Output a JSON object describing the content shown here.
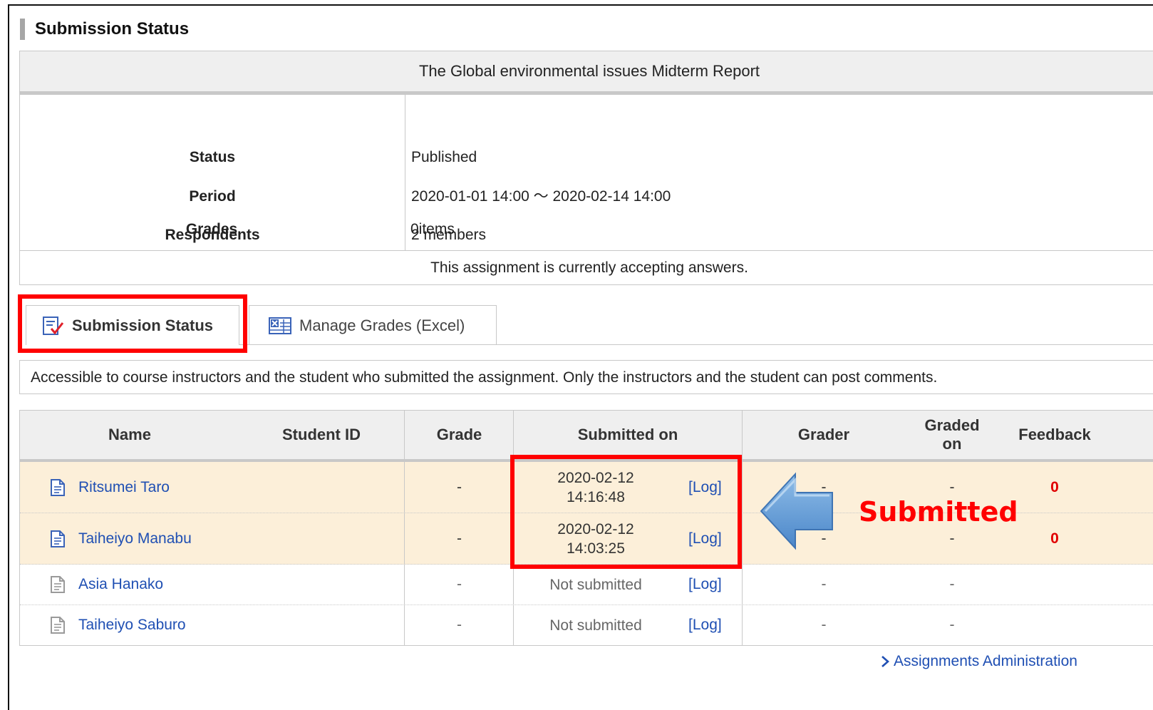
{
  "page_title": "Submission Status",
  "assignment": {
    "title": "The Global environmental issues Midterm Report",
    "rows": [
      {
        "label": "Status",
        "value": "Published"
      },
      {
        "label": "Period",
        "value": "2020-01-01 14:00 ～ 2020-02-14 14:00"
      },
      {
        "label": "Respondents",
        "value": "2 members"
      },
      {
        "label": "Grades",
        "value": "0items"
      }
    ],
    "note": "This assignment is currently accepting answers."
  },
  "tabs": [
    {
      "label": "Submission Status",
      "icon": "checklist-icon",
      "active": true
    },
    {
      "label": "Manage Grades (Excel)",
      "icon": "spreadsheet-icon",
      "active": false
    }
  ],
  "access_note": "Accessible to course instructors and the student who submitted the assignment. Only the instructors and the student can post comments.",
  "table": {
    "headers": {
      "name": "Name",
      "student_id": "Student ID",
      "grade": "Grade",
      "submitted_on": "Submitted on",
      "grader": "Grader",
      "graded_on_1": "Graded",
      "graded_on_2": "on",
      "feedback": "Feedback"
    },
    "rows": [
      {
        "name": "Ritsumei Taro",
        "grade": "-",
        "submitted_date": "2020-02-12",
        "submitted_time": "14:16:48",
        "log": "[Log]",
        "grader": "-",
        "graded_on": "-",
        "feedback": "0"
      },
      {
        "name": "Taiheiyo Manabu",
        "grade": "-",
        "submitted_date": "2020-02-12",
        "submitted_time": "14:03:25",
        "log": "[Log]",
        "grader": "-",
        "graded_on": "-",
        "feedback": "0"
      },
      {
        "name": "Asia Hanako",
        "grade": "-",
        "submitted": "Not submitted",
        "log": "[Log]",
        "grader": "-",
        "graded_on": "-"
      },
      {
        "name": "Taiheiyo Saburo",
        "grade": "-",
        "submitted": "Not submitted",
        "log": "[Log]",
        "grader": "-",
        "graded_on": "-"
      }
    ]
  },
  "annotation": {
    "label": "Submitted",
    "color": "#ff0000",
    "arrow_color": "#5b9bd5"
  },
  "footer_link": "Assignments Administration"
}
